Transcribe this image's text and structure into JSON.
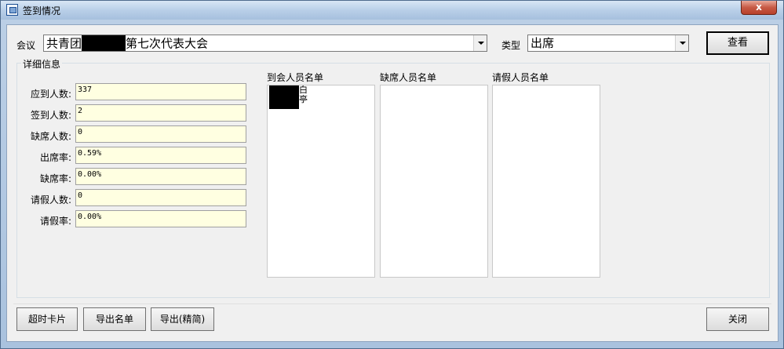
{
  "window": {
    "title": "签到情况",
    "close_label": "x"
  },
  "meeting": {
    "label": "会议",
    "value_prefix": "共青团",
    "value_suffix": "第七次代表大会"
  },
  "type": {
    "label": "类型",
    "value": "出席"
  },
  "buttons": {
    "query": "查看",
    "overtime_card": "超时卡片",
    "export_list": "导出名单",
    "export_simple": "导出(精简)",
    "close": "关闭"
  },
  "details": {
    "title": "详细信息",
    "fields": [
      {
        "label": "应到人数:",
        "value": "337"
      },
      {
        "label": "签到人数:",
        "value": "2"
      },
      {
        "label": "缺席人数:",
        "value": "0"
      },
      {
        "label": "出席率:",
        "value": "0.59%"
      },
      {
        "label": "缺席率:",
        "value": "0.00%"
      },
      {
        "label": "请假人数:",
        "value": "0"
      },
      {
        "label": "请假率:",
        "value": "0.00%"
      }
    ]
  },
  "lists": {
    "attended": {
      "title": "到会人员名单",
      "items": [
        "白",
        "亭"
      ]
    },
    "absent": {
      "title": "缺席人员名单",
      "items": []
    },
    "leave": {
      "title": "请假人员名单",
      "items": []
    }
  }
}
